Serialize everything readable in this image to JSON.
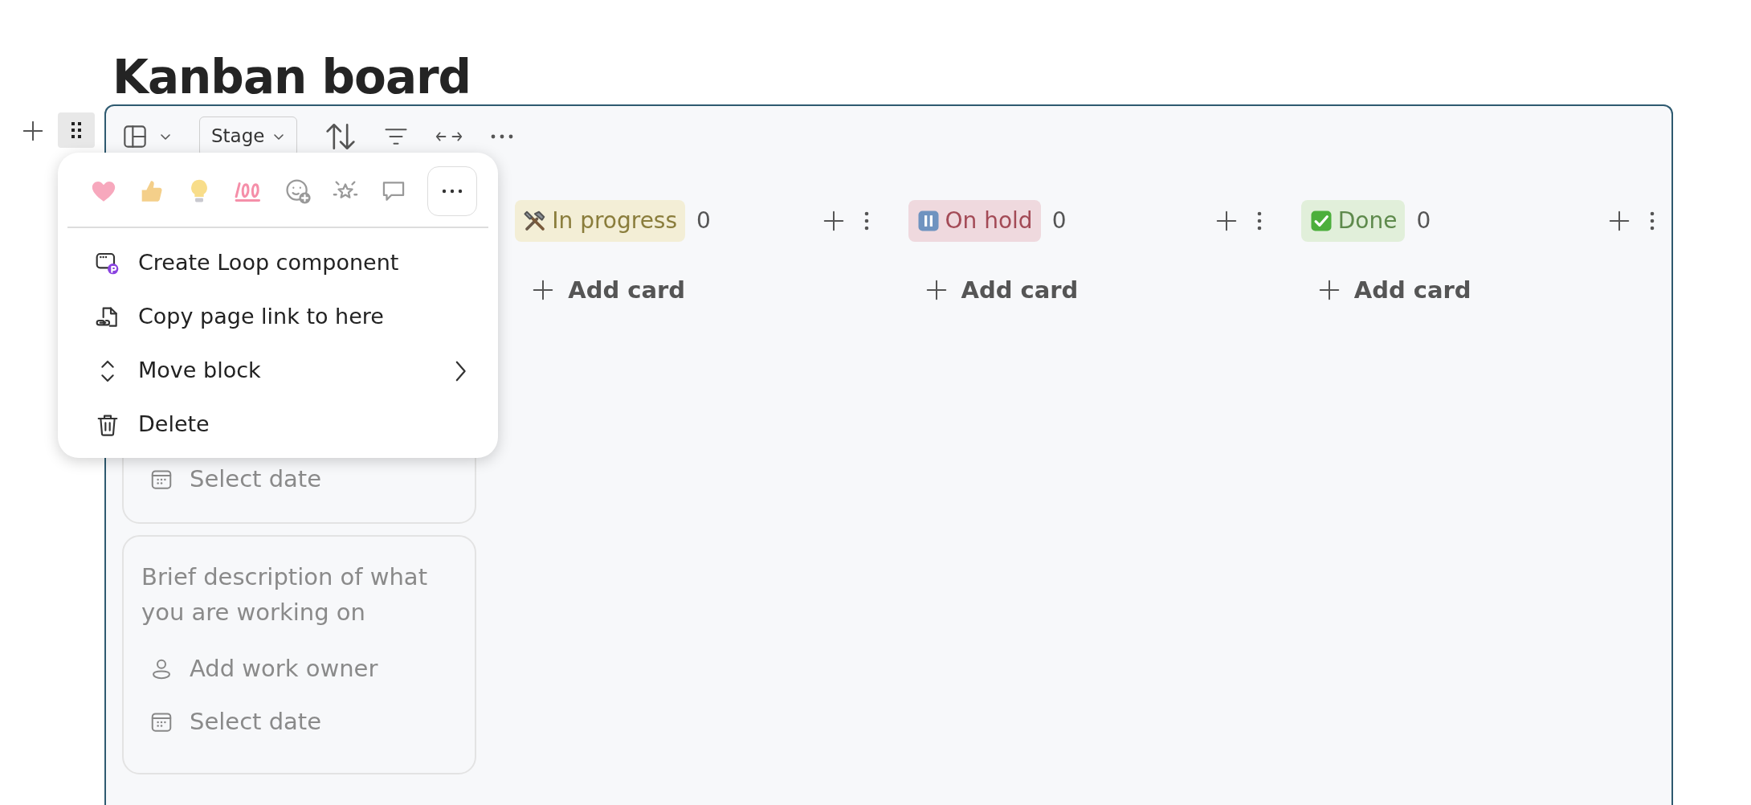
{
  "title": "Kanban board",
  "toolbar": {
    "group_by": "Stage"
  },
  "columns": [
    {
      "cards": [
        {
          "fields": [
            {
              "kind": "date",
              "text": "Select date"
            }
          ]
        },
        {
          "description": "Brief description of what you are working on",
          "fields": [
            {
              "kind": "owner",
              "text": "Add work owner"
            },
            {
              "kind": "date",
              "text": "Select date"
            }
          ]
        }
      ]
    },
    {
      "kind": "in_progress",
      "label": "In progress",
      "color": "#f3eed6",
      "count": "0",
      "add_label": "Add card"
    },
    {
      "kind": "on_hold",
      "label": "On hold",
      "color": "#efd9de",
      "count": "0",
      "add_label": "Add card"
    },
    {
      "kind": "done",
      "label": "Done",
      "color": "#e1efda",
      "count": "0",
      "add_label": "Add card"
    }
  ],
  "menu": {
    "items": [
      {
        "kind": "loop",
        "label": "Create Loop component",
        "submenu": false
      },
      {
        "kind": "link",
        "label": "Copy page link to here",
        "submenu": false
      },
      {
        "kind": "move",
        "label": "Move block",
        "submenu": true
      },
      {
        "kind": "delete",
        "label": "Delete",
        "submenu": false
      }
    ]
  }
}
